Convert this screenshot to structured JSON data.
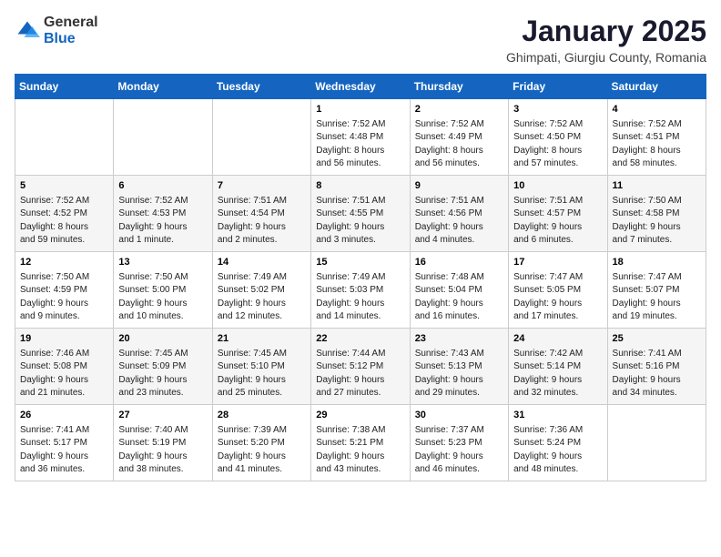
{
  "header": {
    "logo_general": "General",
    "logo_blue": "Blue",
    "title": "January 2025",
    "subtitle": "Ghimpati, Giurgiu County, Romania"
  },
  "days_of_week": [
    "Sunday",
    "Monday",
    "Tuesday",
    "Wednesday",
    "Thursday",
    "Friday",
    "Saturday"
  ],
  "weeks": [
    [
      {
        "day": "",
        "info": ""
      },
      {
        "day": "",
        "info": ""
      },
      {
        "day": "",
        "info": ""
      },
      {
        "day": "1",
        "info": "Sunrise: 7:52 AM\nSunset: 4:48 PM\nDaylight: 8 hours\nand 56 minutes."
      },
      {
        "day": "2",
        "info": "Sunrise: 7:52 AM\nSunset: 4:49 PM\nDaylight: 8 hours\nand 56 minutes."
      },
      {
        "day": "3",
        "info": "Sunrise: 7:52 AM\nSunset: 4:50 PM\nDaylight: 8 hours\nand 57 minutes."
      },
      {
        "day": "4",
        "info": "Sunrise: 7:52 AM\nSunset: 4:51 PM\nDaylight: 8 hours\nand 58 minutes."
      }
    ],
    [
      {
        "day": "5",
        "info": "Sunrise: 7:52 AM\nSunset: 4:52 PM\nDaylight: 8 hours\nand 59 minutes."
      },
      {
        "day": "6",
        "info": "Sunrise: 7:52 AM\nSunset: 4:53 PM\nDaylight: 9 hours\nand 1 minute."
      },
      {
        "day": "7",
        "info": "Sunrise: 7:51 AM\nSunset: 4:54 PM\nDaylight: 9 hours\nand 2 minutes."
      },
      {
        "day": "8",
        "info": "Sunrise: 7:51 AM\nSunset: 4:55 PM\nDaylight: 9 hours\nand 3 minutes."
      },
      {
        "day": "9",
        "info": "Sunrise: 7:51 AM\nSunset: 4:56 PM\nDaylight: 9 hours\nand 4 minutes."
      },
      {
        "day": "10",
        "info": "Sunrise: 7:51 AM\nSunset: 4:57 PM\nDaylight: 9 hours\nand 6 minutes."
      },
      {
        "day": "11",
        "info": "Sunrise: 7:50 AM\nSunset: 4:58 PM\nDaylight: 9 hours\nand 7 minutes."
      }
    ],
    [
      {
        "day": "12",
        "info": "Sunrise: 7:50 AM\nSunset: 4:59 PM\nDaylight: 9 hours\nand 9 minutes."
      },
      {
        "day": "13",
        "info": "Sunrise: 7:50 AM\nSunset: 5:00 PM\nDaylight: 9 hours\nand 10 minutes."
      },
      {
        "day": "14",
        "info": "Sunrise: 7:49 AM\nSunset: 5:02 PM\nDaylight: 9 hours\nand 12 minutes."
      },
      {
        "day": "15",
        "info": "Sunrise: 7:49 AM\nSunset: 5:03 PM\nDaylight: 9 hours\nand 14 minutes."
      },
      {
        "day": "16",
        "info": "Sunrise: 7:48 AM\nSunset: 5:04 PM\nDaylight: 9 hours\nand 16 minutes."
      },
      {
        "day": "17",
        "info": "Sunrise: 7:47 AM\nSunset: 5:05 PM\nDaylight: 9 hours\nand 17 minutes."
      },
      {
        "day": "18",
        "info": "Sunrise: 7:47 AM\nSunset: 5:07 PM\nDaylight: 9 hours\nand 19 minutes."
      }
    ],
    [
      {
        "day": "19",
        "info": "Sunrise: 7:46 AM\nSunset: 5:08 PM\nDaylight: 9 hours\nand 21 minutes."
      },
      {
        "day": "20",
        "info": "Sunrise: 7:45 AM\nSunset: 5:09 PM\nDaylight: 9 hours\nand 23 minutes."
      },
      {
        "day": "21",
        "info": "Sunrise: 7:45 AM\nSunset: 5:10 PM\nDaylight: 9 hours\nand 25 minutes."
      },
      {
        "day": "22",
        "info": "Sunrise: 7:44 AM\nSunset: 5:12 PM\nDaylight: 9 hours\nand 27 minutes."
      },
      {
        "day": "23",
        "info": "Sunrise: 7:43 AM\nSunset: 5:13 PM\nDaylight: 9 hours\nand 29 minutes."
      },
      {
        "day": "24",
        "info": "Sunrise: 7:42 AM\nSunset: 5:14 PM\nDaylight: 9 hours\nand 32 minutes."
      },
      {
        "day": "25",
        "info": "Sunrise: 7:41 AM\nSunset: 5:16 PM\nDaylight: 9 hours\nand 34 minutes."
      }
    ],
    [
      {
        "day": "26",
        "info": "Sunrise: 7:41 AM\nSunset: 5:17 PM\nDaylight: 9 hours\nand 36 minutes."
      },
      {
        "day": "27",
        "info": "Sunrise: 7:40 AM\nSunset: 5:19 PM\nDaylight: 9 hours\nand 38 minutes."
      },
      {
        "day": "28",
        "info": "Sunrise: 7:39 AM\nSunset: 5:20 PM\nDaylight: 9 hours\nand 41 minutes."
      },
      {
        "day": "29",
        "info": "Sunrise: 7:38 AM\nSunset: 5:21 PM\nDaylight: 9 hours\nand 43 minutes."
      },
      {
        "day": "30",
        "info": "Sunrise: 7:37 AM\nSunset: 5:23 PM\nDaylight: 9 hours\nand 46 minutes."
      },
      {
        "day": "31",
        "info": "Sunrise: 7:36 AM\nSunset: 5:24 PM\nDaylight: 9 hours\nand 48 minutes."
      },
      {
        "day": "",
        "info": ""
      }
    ]
  ]
}
